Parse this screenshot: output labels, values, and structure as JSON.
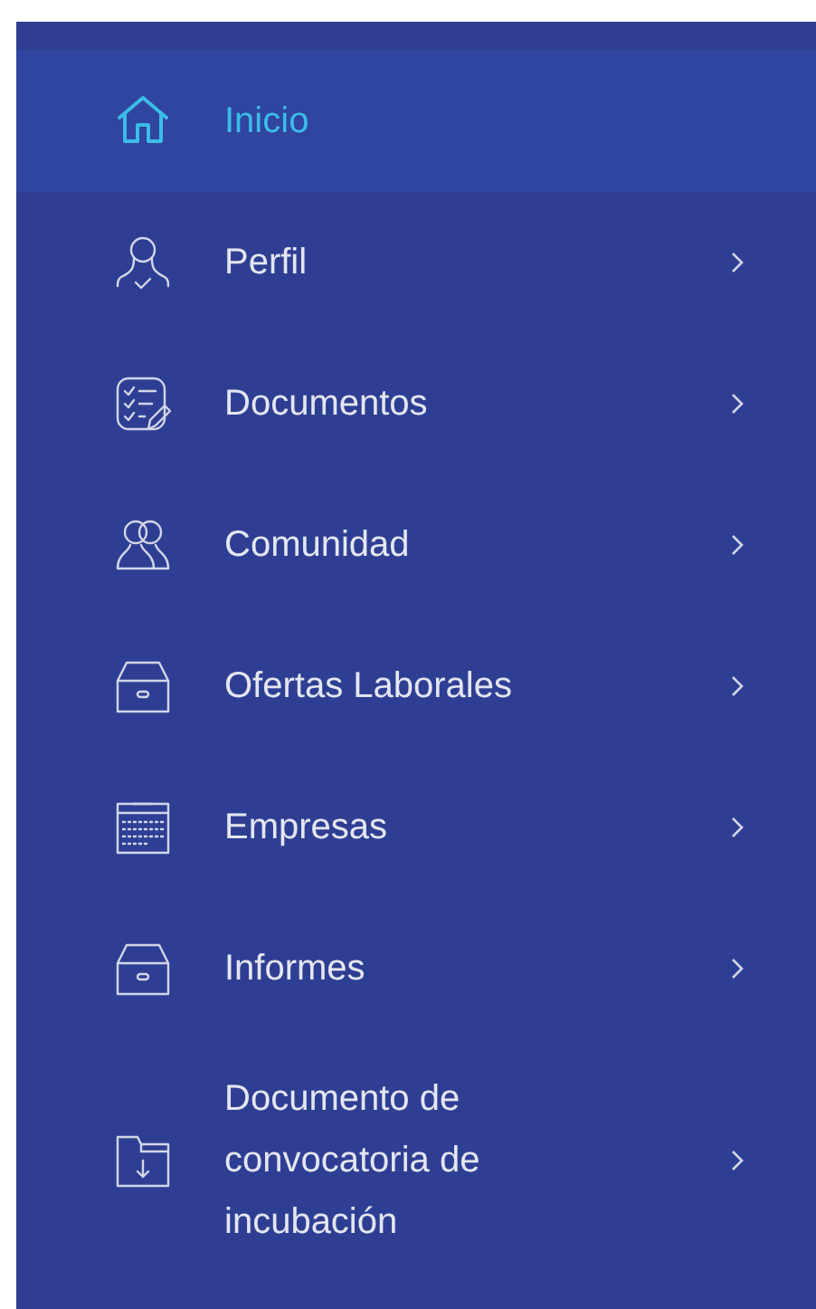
{
  "sidebar": {
    "items": [
      {
        "label": "Inicio",
        "selected": true,
        "has_submenu": false
      },
      {
        "label": "Perfil",
        "selected": false,
        "has_submenu": true
      },
      {
        "label": "Documentos",
        "selected": false,
        "has_submenu": true
      },
      {
        "label": "Comunidad",
        "selected": false,
        "has_submenu": true
      },
      {
        "label": "Ofertas Laborales",
        "selected": false,
        "has_submenu": true
      },
      {
        "label": "Empresas",
        "selected": false,
        "has_submenu": true
      },
      {
        "label": "Informes",
        "selected": false,
        "has_submenu": true
      },
      {
        "label": "Documento de convocatoria de incubación",
        "selected": false,
        "has_submenu": true
      }
    ]
  }
}
